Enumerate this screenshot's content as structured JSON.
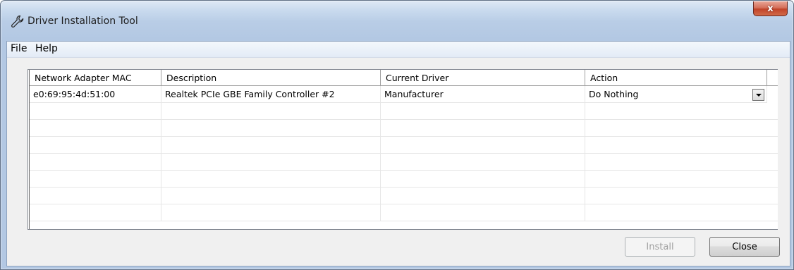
{
  "window": {
    "title": "Driver Installation Tool",
    "close_glyph": "x",
    "icon": "wrench-icon"
  },
  "menu": {
    "file": "File",
    "help": "Help"
  },
  "table": {
    "columns": [
      "Network Adapter MAC",
      "Description",
      "Current Driver",
      "Action"
    ],
    "rows": [
      {
        "mac": "e0:69:95:4d:51:00",
        "description": "Realtek PCIe GBE Family Controller #2",
        "current_driver": "Manufacturer",
        "action": "Do Nothing"
      }
    ]
  },
  "buttons": {
    "install": "Install",
    "close": "Close"
  }
}
